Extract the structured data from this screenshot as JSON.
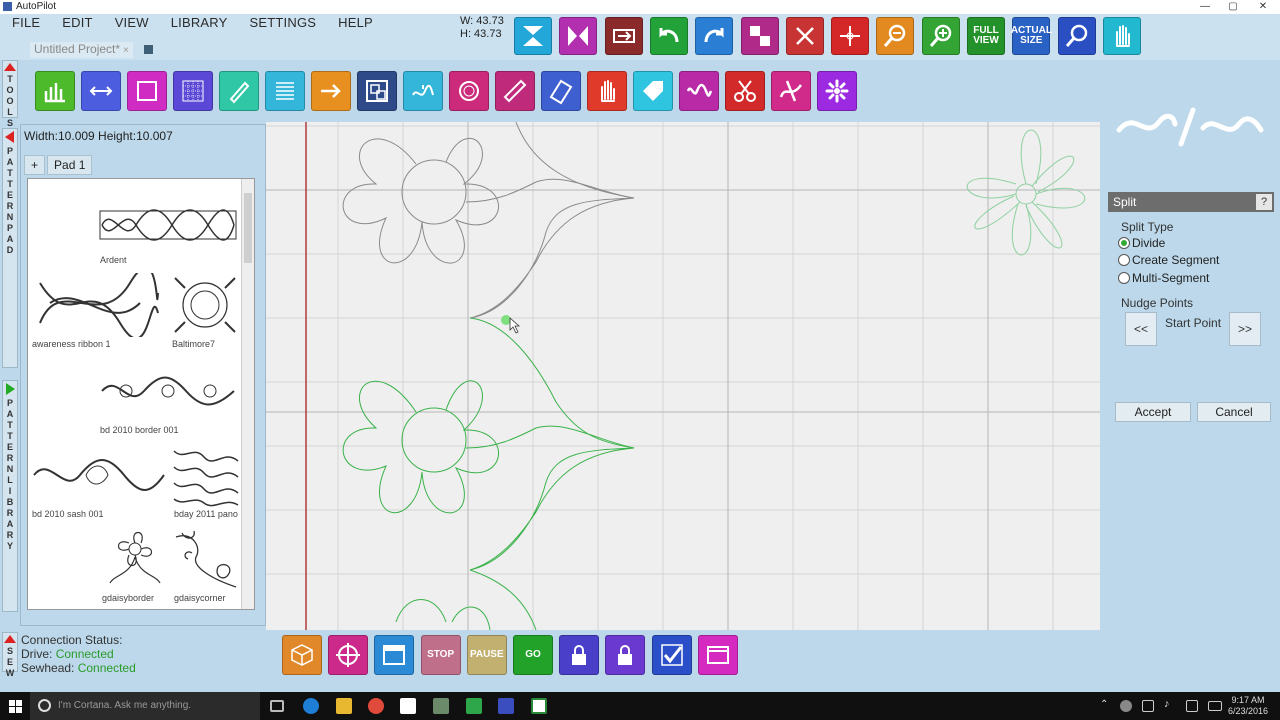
{
  "window": {
    "title": "AutoPilot",
    "min": "—",
    "max": "▢",
    "close": "✕"
  },
  "menu": [
    "FILE",
    "EDIT",
    "VIEW",
    "LIBRARY",
    "SETTINGS",
    "HELP"
  ],
  "dims": {
    "w": "W: 43.73",
    "h": "H: 43.73"
  },
  "project": {
    "name": "Untitled Project*",
    "close": "×"
  },
  "top_toolbar": [
    {
      "name": "vertical-flip",
      "color": "#22a7d8",
      "icon": "flip-v"
    },
    {
      "name": "horizontal-flip",
      "color": "#b22fb0",
      "icon": "flip-h"
    },
    {
      "name": "rotate",
      "color": "#8a2a2a",
      "icon": "rotate"
    },
    {
      "name": "undo",
      "color": "#23a23a",
      "icon": "undo"
    },
    {
      "name": "redo",
      "color": "#2a7fd4",
      "icon": "redo"
    },
    {
      "name": "checker",
      "color": "#b02a8a",
      "icon": "checker"
    },
    {
      "name": "delete",
      "color": "#c83333",
      "icon": "x"
    },
    {
      "name": "crosshair-move",
      "color": "#d42828",
      "icon": "plus"
    },
    {
      "name": "zoom-out",
      "color": "#e28a1f",
      "icon": "zoom-out"
    },
    {
      "name": "zoom-in",
      "color": "#34a534",
      "icon": "zoom-in"
    },
    {
      "name": "full-view",
      "color": "#24922a",
      "label": "FULL VIEW"
    },
    {
      "name": "actual-size",
      "color": "#2a61c4",
      "label": "ACTUAL SIZE"
    },
    {
      "name": "zoom",
      "color": "#2a4fc2",
      "icon": "zoom"
    },
    {
      "name": "hand",
      "color": "#22b8cf",
      "icon": "hand"
    }
  ],
  "tool_row": [
    {
      "name": "stitch-graph",
      "color": "#4cba2a",
      "icon": "bars"
    },
    {
      "name": "measure",
      "color": "#4d5de0",
      "icon": "arrows"
    },
    {
      "name": "rectangle",
      "color": "#d02cc4",
      "icon": "rect"
    },
    {
      "name": "grid-fill",
      "color": "#5b48d6",
      "icon": "grid"
    },
    {
      "name": "text",
      "color": "#2fc7a6",
      "icon": "pen"
    },
    {
      "name": "rows",
      "color": "#33b6d9",
      "icon": "lines"
    },
    {
      "name": "arrow-tool",
      "color": "#e8901f",
      "icon": "arrow-right"
    },
    {
      "name": "nest",
      "color": "#2f4a88",
      "icon": "squares"
    },
    {
      "name": "path",
      "color": "#33b6d9",
      "icon": "curve"
    },
    {
      "name": "heart",
      "color": "#cc2a7a",
      "icon": "heart"
    },
    {
      "name": "ruler",
      "color": "#c02a7a",
      "icon": "ruler"
    },
    {
      "name": "stencil",
      "color": "#3e5fd0",
      "icon": "stencil"
    },
    {
      "name": "hand-stop",
      "color": "#e03a2a",
      "icon": "hand"
    },
    {
      "name": "tag",
      "color": "#2fc4e0",
      "icon": "tag"
    },
    {
      "name": "wave",
      "color": "#b82aa6",
      "icon": "wave"
    },
    {
      "name": "scissors",
      "color": "#d22a2a",
      "icon": "scissors"
    },
    {
      "name": "split-line",
      "color": "#d02a8a",
      "icon": "split"
    },
    {
      "name": "flower",
      "color": "#9c2ae0",
      "icon": "flower"
    }
  ],
  "side_tabs": {
    "tools": "T O O L S",
    "pattern_pad": "P A T T E R N P A D",
    "pattern_library": "P A T T E R N L I B R A R Y",
    "sew": "S E W"
  },
  "pad": {
    "dims": "Width:10.009 Height:10.007",
    "tabs": [
      "+",
      "Pad 1"
    ],
    "patterns": [
      {
        "label": "Ardent"
      },
      {
        "label": "awareness ribbon 1"
      },
      {
        "label": "Baltimore7"
      },
      {
        "label": "bd 2010 border 001"
      },
      {
        "label": "bd 2010 sash 001"
      },
      {
        "label": "bday 2011 pano"
      },
      {
        "label": "gdaisyborder"
      },
      {
        "label": "gdaisycorner"
      }
    ]
  },
  "split": {
    "title": "Split",
    "help": "?",
    "type_label": "Split Type",
    "options": [
      {
        "label": "Divide",
        "selected": true
      },
      {
        "label": "Create Segment",
        "selected": false
      },
      {
        "label": "Multi-Segment",
        "selected": false
      }
    ],
    "nudge_label": "Nudge Points",
    "prev": "<<",
    "start": "Start Point",
    "next": ">>",
    "accept": "Accept",
    "cancel": "Cancel"
  },
  "connection": {
    "title": "Connection Status:",
    "drive_label": "Drive:",
    "drive_value": "Connected",
    "sewhead_label": "Sewhead:",
    "sewhead_value": "Connected"
  },
  "bottom_toolbar": [
    {
      "name": "trace",
      "color": "#e1892a",
      "icon": "cube"
    },
    {
      "name": "target",
      "color": "#cc2a8a",
      "icon": "target"
    },
    {
      "name": "frame",
      "color": "#2a8ad6",
      "icon": "frame"
    },
    {
      "name": "stop",
      "color": "#bf6f8a",
      "label": "STOP"
    },
    {
      "name": "pause",
      "color": "#c2b070",
      "label": "PAUSE"
    },
    {
      "name": "go",
      "color": "#23a22a",
      "label": "GO"
    },
    {
      "name": "lock-1",
      "color": "#4a3fc8",
      "icon": "lock"
    },
    {
      "name": "lock-2",
      "color": "#6a3ad0",
      "icon": "lock"
    },
    {
      "name": "check",
      "color": "#2a4fc8",
      "icon": "check"
    },
    {
      "name": "window",
      "color": "#d42ac0",
      "icon": "window"
    }
  ],
  "taskbar": {
    "cortana": "I'm Cortana. Ask me anything.",
    "time": "9:17 AM",
    "date": "6/23/2016"
  }
}
